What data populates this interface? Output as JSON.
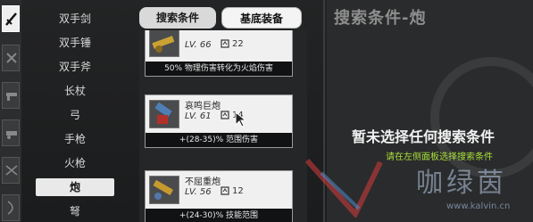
{
  "sidebar": {
    "categories": [
      "双手剑",
      "双手锤",
      "双手斧",
      "长杖",
      "弓",
      "手枪",
      "火枪",
      "炮",
      "弩"
    ],
    "active_category": "炮"
  },
  "tabs": {
    "search_conditions": "搜索条件",
    "base_equipment": "基底装备"
  },
  "items": [
    {
      "name": "",
      "level": "LV. 66",
      "slots": "22",
      "effect": "50% 物理伤害转化为火焰伤害"
    },
    {
      "name": "哀鸣巨炮",
      "level": "LV. 61",
      "slots": "14",
      "effect": "+(28-35)% 范围伤害"
    },
    {
      "name": "不屈重炮",
      "level": "LV. 56",
      "slots": "12",
      "effect": "+(24-30)% 技能范围"
    }
  ],
  "right_panel": {
    "title": "搜索条件-炮",
    "empty_message": "暂未选择任何搜索条件",
    "hint": "请在左侧面板选择搜索条件"
  },
  "watermark": {
    "text": "咖绿茵",
    "url": "www.kalvin.cn"
  },
  "colors": {
    "hint": "#a8e03a",
    "active_item": "#e9e9e9",
    "watermark": "#b4c8e1"
  },
  "icons": [
    "sword-icon",
    "cancel-icon",
    "gun-icon",
    "cannon-icon",
    "crossbow-icon",
    "slot-icon",
    "cursor-icon"
  ]
}
